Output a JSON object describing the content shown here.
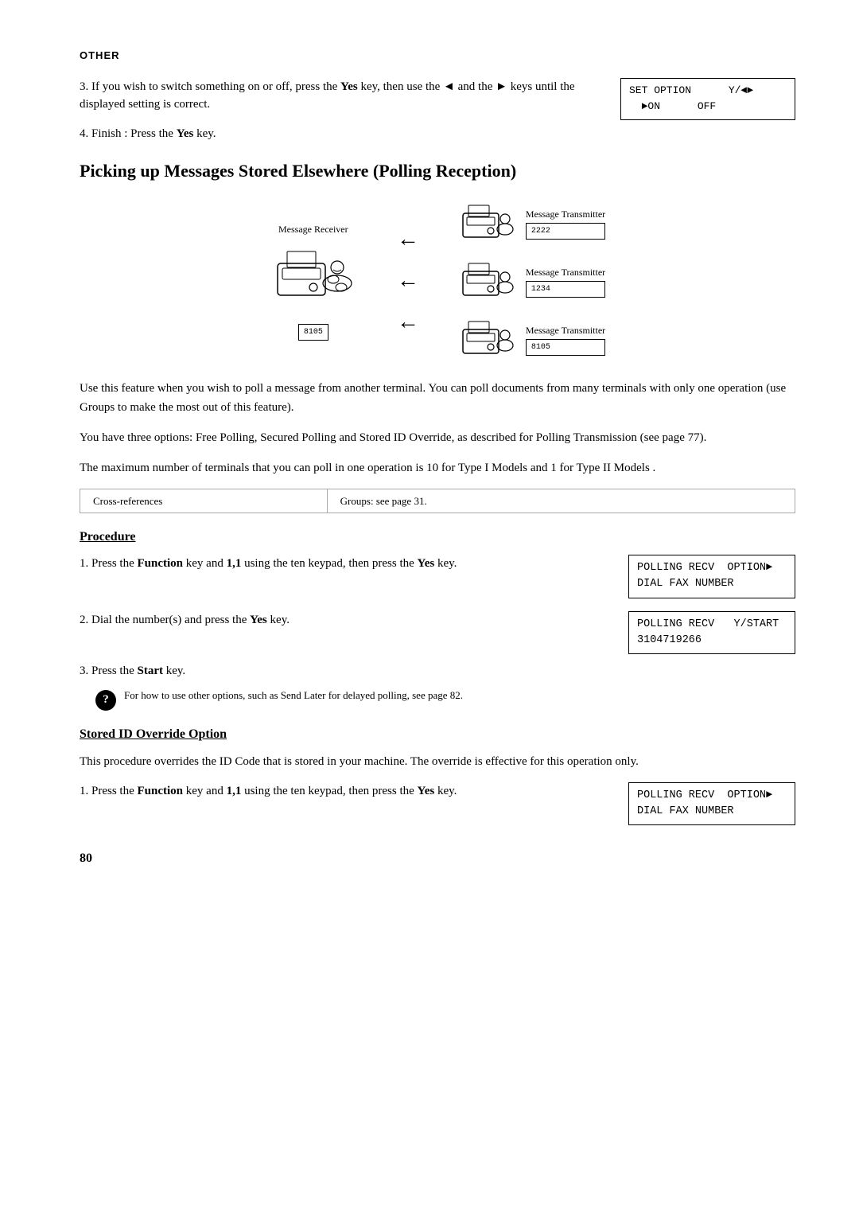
{
  "header": {
    "section_label": "Other"
  },
  "intro_steps": [
    {
      "num": "3.",
      "text_before": "If you wish to switch something on or off, press the ",
      "bold1": "Yes",
      "text_mid": " key, then use the ◄ and the ► keys until the displayed setting is correct.",
      "has_lcd": true,
      "lcd_line1": "SET OPTION      Y/◄►",
      "lcd_line2": "  ►ON      OFF"
    },
    {
      "num": "4.",
      "text": "Finish : Press the ",
      "bold": "Yes",
      "text_end": " key.",
      "has_lcd": false
    }
  ],
  "main_title": "Picking up Messages Stored Elsewhere (Polling Reception)",
  "diagram": {
    "receiver_label": "Message Receiver",
    "receiver_code": "8105",
    "transmitters": [
      {
        "label": "Message Transmitter",
        "code": "2222"
      },
      {
        "label": "Message Transmitter",
        "code": "1234"
      },
      {
        "label": "Message Transmitter",
        "code": "8105"
      }
    ]
  },
  "body_paragraphs": [
    "Use this feature when you wish to poll a message from another terminal. You can poll documents from many terminals with only one operation (use Groups to make the most out of this feature).",
    "You have three options: Free Polling, Secured Polling and Stored ID Override, as described for Polling Transmission (see page 77).",
    "The maximum number of terminals that you can poll in one operation is 10 for Type I Models and 1 for Type II Models ."
  ],
  "cross_ref": {
    "left": "Cross-references",
    "right": "Groups: see page 31."
  },
  "procedure": {
    "heading": "Procedure",
    "steps": [
      {
        "num": "1.",
        "text_before": "Press the ",
        "bold1": "Function",
        "text_mid": " key and ",
        "bold2": "1,1",
        "text_end": " using the ten keypad, then press the ",
        "bold3": "Yes",
        "text_final": " key.",
        "lcd_line1": "POLLING RECV  OPTION►",
        "lcd_line2": "DIAL FAX NUMBER"
      },
      {
        "num": "2.",
        "text_before": "Dial the number(s) and press the ",
        "bold1": "Yes",
        "text_end": " key.",
        "lcd_line1": "POLLING RECV   Y/START",
        "lcd_line2": "3104719266"
      },
      {
        "num": "3.",
        "text_before": "Press the ",
        "bold1": "Start",
        "text_end": " key.",
        "has_note": true
      }
    ],
    "note": {
      "text_before": "For how to use other options, such as Send Later for delayed polling, see page 82."
    }
  },
  "stored_id": {
    "heading": "Stored ID Override Option",
    "body": "This procedure overrides the ID Code that is stored in your machine. The override is effective for this operation only.",
    "steps": [
      {
        "num": "1.",
        "text_before": "Press the ",
        "bold1": "Function",
        "text_mid": " key and ",
        "bold2": "1,1",
        "text_end": " using the ten keypad, then press the ",
        "bold3": "Yes",
        "text_final": " key.",
        "lcd_line1": "POLLING RECV  OPTION►",
        "lcd_line2": "DIAL FAX NUMBER"
      }
    ]
  },
  "page_number": "80"
}
